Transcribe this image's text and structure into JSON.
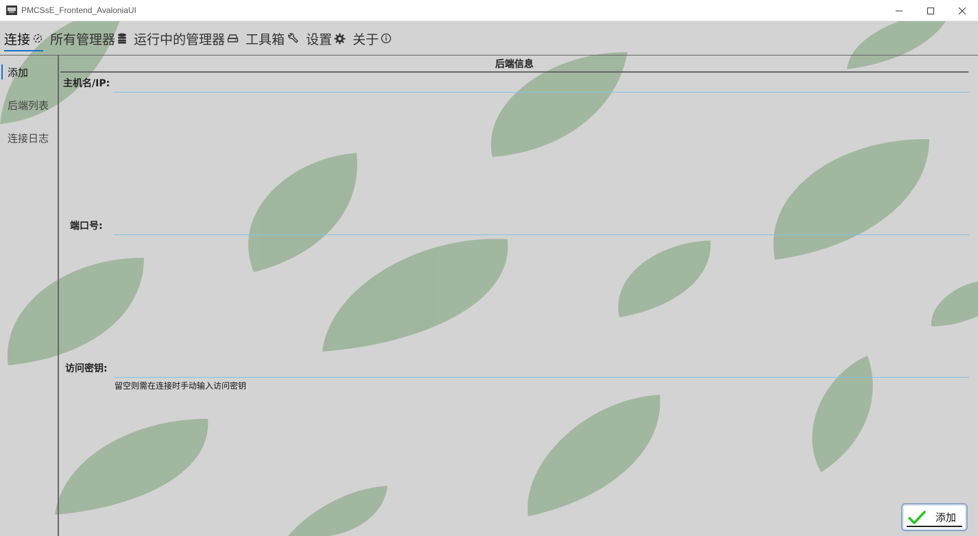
{
  "window": {
    "title": "PMCSsE_Frontend_AvaloniaUI"
  },
  "tabs": [
    {
      "label": "连接",
      "icon": "plug-icon",
      "active": true
    },
    {
      "label": "所有管理器",
      "icon": "database-icon",
      "active": false
    },
    {
      "label": "运行中的管理器",
      "icon": "hard-drive-icon",
      "active": false
    },
    {
      "label": "工具箱",
      "icon": "wrench-icon",
      "active": false
    },
    {
      "label": "设置",
      "icon": "gear-icon",
      "active": false
    },
    {
      "label": "关于",
      "icon": "info-icon",
      "active": false
    }
  ],
  "sidebar": {
    "items": [
      {
        "label": "添加",
        "active": true
      },
      {
        "label": "后端列表",
        "active": false
      },
      {
        "label": "连接日志",
        "active": false
      }
    ]
  },
  "form": {
    "header": "后端信息",
    "host_label": "主机名/IP:",
    "host_value": "",
    "port_label": "端口号:",
    "port_value": "",
    "key_label": "访问密钥:",
    "key_value": "",
    "key_hint": "留空则需在连接时手动输入访问密钥",
    "add_label": "添加"
  },
  "colors": {
    "accent": "#1a73c8",
    "input_underline": "#7fc4e6",
    "background": "#d3d3d3",
    "leaf": "#9fb59c",
    "check": "#22c922"
  }
}
